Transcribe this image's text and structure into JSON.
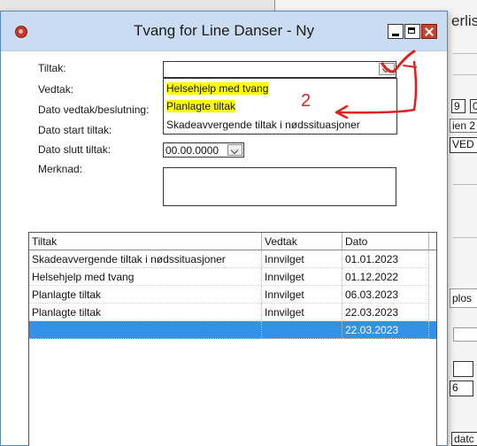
{
  "background": {
    "title_partial": "erlis",
    "fields": [
      "9",
      "0",
      "ien 2",
      "VED",
      "plos",
      "6",
      "datc"
    ]
  },
  "dialog": {
    "title": "Tvang for Line Danser - Ny",
    "labels": {
      "tiltak": "Tiltak:",
      "vedtak": "Vedtak:",
      "dato_vedtak": "Dato vedtak/beslutning:",
      "dato_start": "Dato start tiltak:",
      "dato_slutt": "Dato slutt tiltak:",
      "merknad": "Merknad:"
    },
    "dato_slutt_value": "00.00.0000",
    "dropdown_options": [
      "Helsehjelp med tvang",
      "Planlagte tiltak",
      "Skadeavvergende tiltak i nødssituasjoner"
    ]
  },
  "annotation": {
    "text": "2"
  },
  "table": {
    "headers": [
      "Tiltak",
      "Vedtak",
      "Dato"
    ],
    "rows": [
      {
        "tiltak": "Skadeavvergende tiltak i nødssituasjoner",
        "vedtak": "Innvilget",
        "dato": "01.01.2023"
      },
      {
        "tiltak": "Helsehjelp med tvang",
        "vedtak": "Innvilget",
        "dato": "01.12.2022"
      },
      {
        "tiltak": "Planlagte tiltak",
        "vedtak": "Innvilget",
        "dato": "06.03.2023"
      },
      {
        "tiltak": "Planlagte tiltak",
        "vedtak": "Innvilget",
        "dato": "22.03.2023"
      },
      {
        "tiltak": "",
        "vedtak": "",
        "dato": "22.03.2023"
      }
    ]
  },
  "colors": {
    "titlebar": "#c9dcf1",
    "selection": "#3391e8",
    "highlight": "#ffff00",
    "annotation": "#e02020"
  }
}
